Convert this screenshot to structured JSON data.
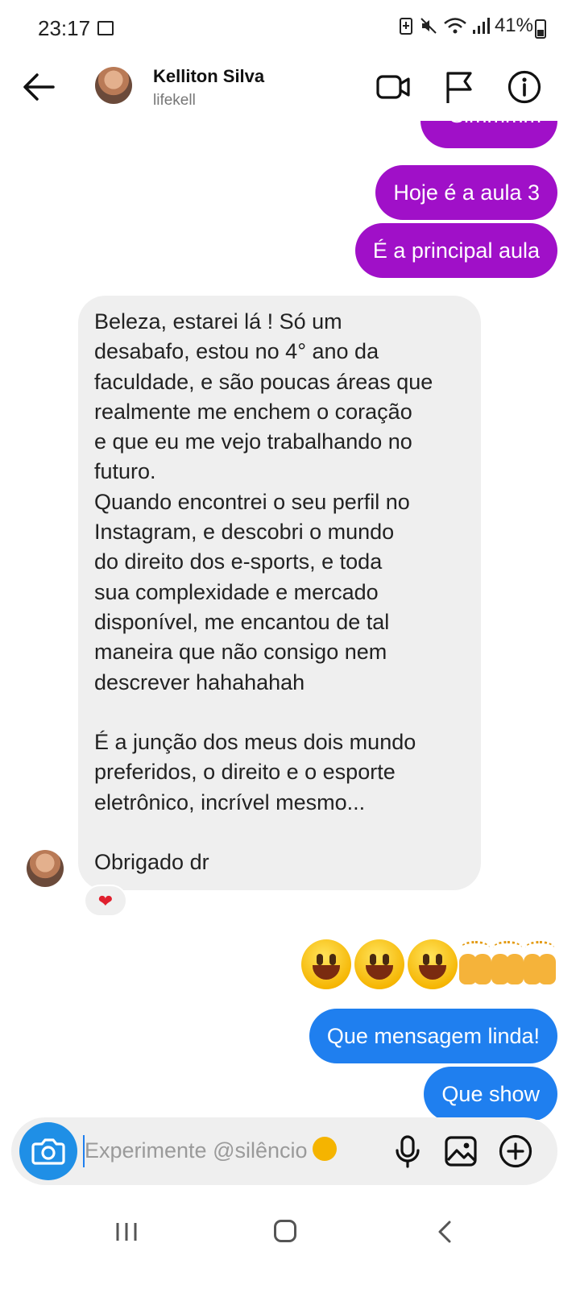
{
  "status_bar": {
    "time": "23:17",
    "battery": "41%",
    "icons": [
      "image-icon",
      "battery-saver-icon",
      "mute-icon",
      "wifi-icon",
      "signal-icon",
      "battery-icon"
    ]
  },
  "header": {
    "name": "Kelliton Silva",
    "username": "lifekell",
    "icons": [
      "back-arrow-icon",
      "video-call-icon",
      "flag-icon",
      "info-icon"
    ]
  },
  "messages": {
    "partial_top": "Simmmm",
    "out_1": "Hoje é a aula 3",
    "out_2": "É a principal aula",
    "incoming_text": "Beleza, estarei lá ! Só um\ndesabafo, estou no 4° ano da\nfaculdade, e são poucas áreas que\nrealmente me enchem o coração\ne que eu me vejo trabalhando no\nfuturo.\nQuando encontrei o seu perfil no\nInstagram, e descobri o mundo\ndo direito dos e-sports, e toda\nsua complexidade e mercado\ndisponível, me encantou de tal\nmaneira que não consigo nem\ndescrever hahahahah\n\nÉ a junção dos meus dois mundo\npreferidos, o direito e o esporte\neletrônico, incrível mesmo...\n\nObrigado dr",
    "reaction": "heart-reaction",
    "emoji_row": [
      "grinning-face",
      "grinning-face",
      "grinning-face",
      "raising-hands",
      "raising-hands",
      "raising-hands"
    ],
    "out_3": "Que mensagem linda!",
    "out_4": "Que show"
  },
  "input": {
    "placeholder": "Experimente @silêncio",
    "icons": [
      "camera-icon",
      "microphone-icon",
      "gallery-icon",
      "plus-icon"
    ]
  },
  "colors": {
    "purple_bubble": "#a010c8",
    "blue_bubble": "#1f7fef",
    "incoming_bubble": "#efefef",
    "camera_button": "#1f8fe6"
  }
}
